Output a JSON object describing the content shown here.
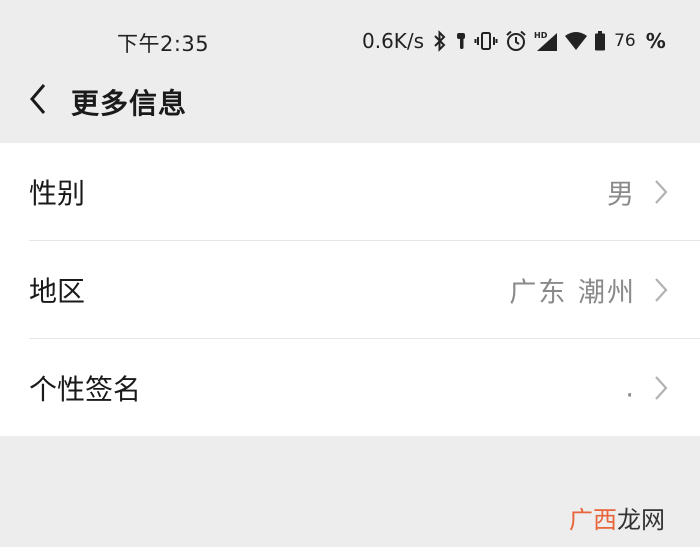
{
  "status_bar": {
    "time": "下午2:35",
    "net_speed": "0.6K/s",
    "battery_level": "76",
    "percent_sign": "%",
    "icons": [
      "bluetooth-icon",
      "earbud-icon",
      "vibrate-icon",
      "alarm-icon",
      "hd-signal-icon",
      "wifi-icon",
      "battery-icon"
    ]
  },
  "nav": {
    "title": "更多信息",
    "back_icon": "chevron-left-icon"
  },
  "rows": [
    {
      "label": "性别",
      "value": "男"
    },
    {
      "label": "地区",
      "value": "广东 潮州"
    },
    {
      "label": "个性签名",
      "value": "."
    }
  ],
  "watermark": {
    "accent": "广西",
    "rest": "龙网"
  },
  "colors": {
    "background": "#ededed",
    "card": "#ffffff",
    "value_text": "#8a8a8a",
    "chevron": "#b2b2b2",
    "watermark_accent": "#e8643a"
  }
}
